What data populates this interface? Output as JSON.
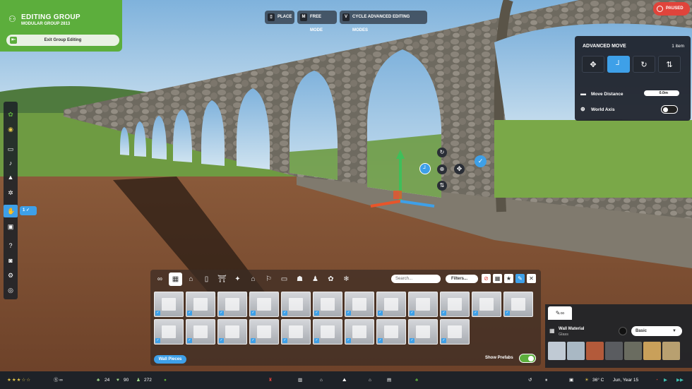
{
  "group": {
    "title": "EDITING GROUP",
    "subtitle": "MODULAR GROUP 2813",
    "exit_label": "Exit Group Editing"
  },
  "hints": [
    {
      "key": "",
      "label": "PLACE"
    },
    {
      "key": "M",
      "label": "FREE MODE"
    },
    {
      "key": "V",
      "label": "CYCLE ADVANCED EDITING MODES"
    }
  ],
  "status": {
    "paused_label": "PAUSED"
  },
  "advanced_move": {
    "title": "ADVANCED MOVE",
    "count": "1 item",
    "modes": [
      {
        "icon": "move-icon",
        "glyph": "✥",
        "active": false
      },
      {
        "icon": "snap-corner-icon",
        "glyph": "┘",
        "active": true
      },
      {
        "icon": "rotate-icon",
        "glyph": "↻",
        "active": false
      },
      {
        "icon": "align-icon",
        "glyph": "⇅",
        "active": false
      }
    ],
    "move_distance_label": "Move Distance",
    "move_distance_value": "0.0m",
    "world_axis_label": "World Axis",
    "world_axis_on": false
  },
  "selection": {
    "count": "1"
  },
  "browser": {
    "search_placeholder": "Search...",
    "filters_label": "Filters...",
    "tabs": [
      "∞",
      "▦",
      "⌂",
      "▯",
      "⛩",
      "✦",
      "⌂",
      "⚐",
      "▭",
      "☗",
      "♟",
      "✿",
      "❄"
    ],
    "active_tab": 1,
    "bottom_tab": "Wall Pieces",
    "show_prefabs_label": "Show Prefabs",
    "show_prefabs_on": true,
    "row_counts": [
      12,
      10
    ]
  },
  "material": {
    "label": "Wall Material",
    "sub": "Glass",
    "select": "Basic",
    "swatch_colors": [
      "#c0cad4",
      "#a9b8c4",
      "#b35a3a",
      "#5a5c60",
      "#6a6c60",
      "#c9a05a",
      "#b8a070"
    ]
  },
  "bottom": {
    "cash": "24",
    "guests": "90",
    "staff": "272",
    "temperature": "36° C",
    "date": "Jun, Year 15"
  }
}
